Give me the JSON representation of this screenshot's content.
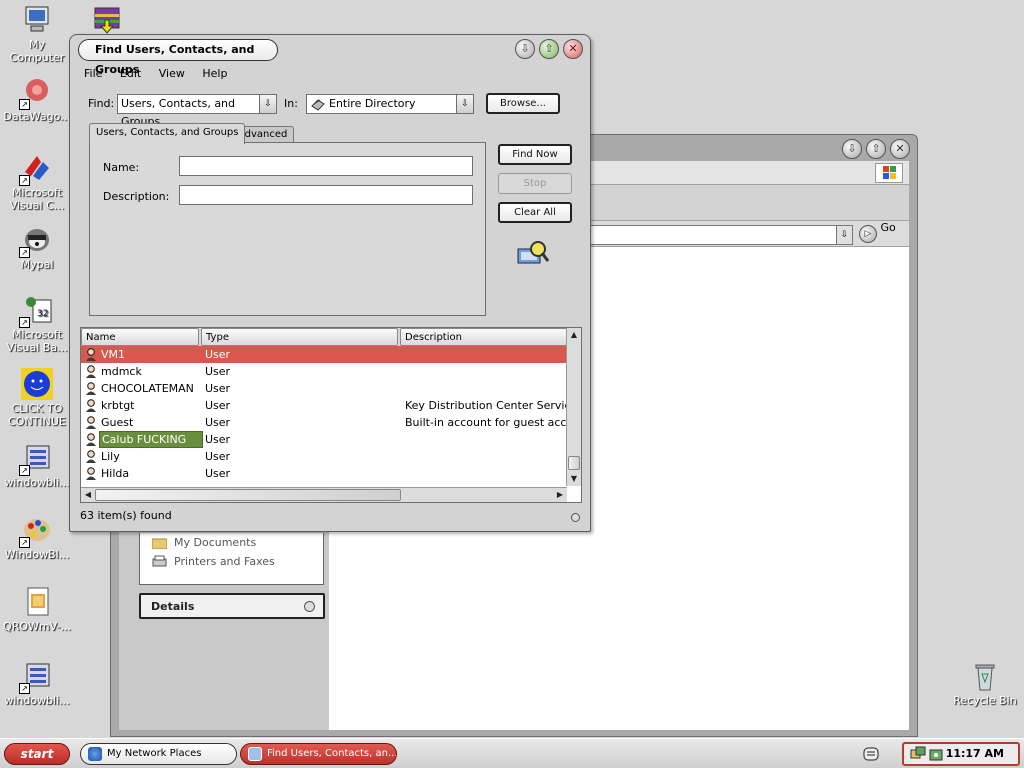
{
  "desktop_icons": [
    {
      "label": "My Computer",
      "icon": "computer-icon"
    },
    {
      "label": "DataWago...",
      "icon": "datawago-icon"
    },
    {
      "label": "Microsoft Visual C...",
      "icon": "visual-c-icon"
    },
    {
      "label": "Mypal",
      "icon": "mypal-icon"
    },
    {
      "label": "Microsoft Visual Ba...",
      "icon": "visual-basic-icon"
    },
    {
      "label": "CLICK TO CONTINUE",
      "icon": "smiley-icon"
    },
    {
      "label": "windowbli...",
      "icon": "windowblinds-icon"
    },
    {
      "label": "WindowBl...",
      "icon": "windowblinds-paint-icon"
    },
    {
      "label": "QROWmV-...",
      "icon": "document-icon"
    },
    {
      "label": "windowbli...",
      "icon": "windowblinds-icon"
    },
    {
      "label": "Recycle Bin",
      "icon": "recycle-bin-icon"
    }
  ],
  "back_window": {
    "addr_go": "Go",
    "tasks": [
      "My Documents",
      "Printers and Faxes"
    ],
    "details_label": "Details"
  },
  "dialog": {
    "title": "Find Users, Contacts, and Groups",
    "menu": [
      "File",
      "Edit",
      "View",
      "Help"
    ],
    "find_label": "Find:",
    "find_value": "Users, Contacts, and Groups",
    "in_label": "In:",
    "in_value": "Entire Directory",
    "browse_label": "Browse...",
    "tabs": [
      "Users, Contacts, and Groups",
      "Advanced"
    ],
    "name_label": "Name:",
    "name_value": "",
    "description_label": "Description:",
    "description_value": "",
    "find_now_label": "Find Now",
    "stop_label": "Stop",
    "clear_all_label": "Clear All",
    "columns": [
      "Name",
      "Type",
      "Description"
    ],
    "rows": [
      {
        "name": "VM1",
        "type": "User",
        "description": ""
      },
      {
        "name": "mdmck",
        "type": "User",
        "description": ""
      },
      {
        "name": "CHOCOLATEMAN",
        "type": "User",
        "description": ""
      },
      {
        "name": "krbtgt",
        "type": "User",
        "description": "Key Distribution Center Service Ac"
      },
      {
        "name": "Guest",
        "type": "User",
        "description": "Built-in account for guest access t"
      },
      {
        "name": "Calub FUCKING Veim",
        "type": "User",
        "description": ""
      },
      {
        "name": "Lily",
        "type": "User",
        "description": ""
      },
      {
        "name": "Hilda",
        "type": "User",
        "description": ""
      }
    ],
    "status": "63 item(s) found"
  },
  "taskbar": {
    "start_label": "start",
    "tasks": [
      "My Network Places",
      "Find Users, Contacts, an..."
    ],
    "clock": "11:17 AM"
  },
  "colors": {
    "selection": "#d9574f",
    "rename": "#6a8f3c",
    "start": "#c23a32"
  }
}
